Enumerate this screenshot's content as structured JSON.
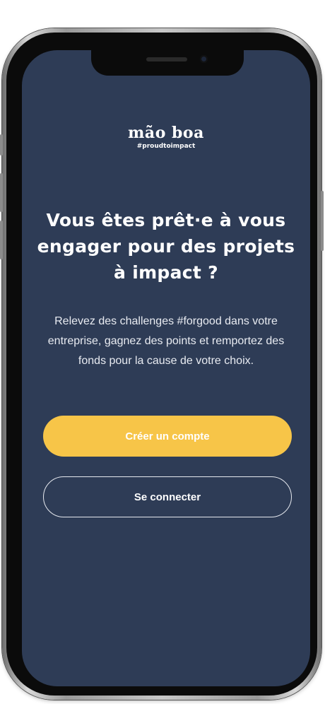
{
  "logo": {
    "name": "mão boa",
    "tagline": "#proudtoimpact"
  },
  "onboarding": {
    "headline": "Vous êtes prêt·e à vous engager pour des projets à impact ?",
    "description": "Relevez des challenges #forgood dans votre entreprise, gagnez des points et remportez des fonds pour la cause de votre choix."
  },
  "actions": {
    "create_account_label": "Créer un compte",
    "login_label": "Se connecter"
  },
  "colors": {
    "background": "#2e3c56",
    "primary_button": "#f7c548",
    "text": "#ffffff"
  }
}
